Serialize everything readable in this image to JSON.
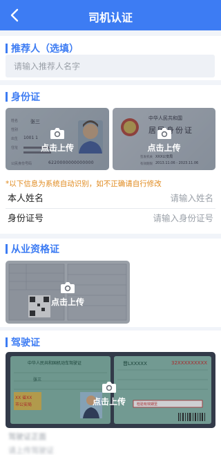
{
  "header": {
    "title": "司机认证",
    "back_icon": "chevron-left-icon"
  },
  "referrer": {
    "title": "推荐人（选填）",
    "placeholder": "请输入推荐人名字"
  },
  "id_card": {
    "title": "身份证",
    "front": {
      "upload_label": "点击上传",
      "card_text": {
        "name_label": "姓名",
        "name": "张三",
        "sex_label": "性别",
        "birth_label": "出生",
        "birth": "1001 1",
        "address_label": "住址",
        "number_label": "公民身份号码",
        "number": "6220000000000000"
      }
    },
    "back": {
      "upload_label": "点击上传",
      "card_text": {
        "country": "中华人民共和国",
        "card_title": "居民身份证",
        "authority": "XXX公安局",
        "valid": "2013.11.06 - 2023.11.06"
      }
    },
    "notice": "*以下信息为系统自动识别，如不正确请自行修改",
    "fields": [
      {
        "label": "本人姓名",
        "placeholder": "请输入姓名"
      },
      {
        "label": "身份证号",
        "placeholder": "请输入身份证号"
      }
    ]
  },
  "qualification": {
    "title": "从业资格证",
    "upload_label": "点击上传"
  },
  "license": {
    "title": "驾驶证",
    "upload_label": "点击上传",
    "card_text": {
      "header": "中华人民共和国机动车驾驶证",
      "name": "张三",
      "number": "32XXXXXXXXX",
      "plate": "晋LXXXXX",
      "footer": "检验有效期至"
    }
  },
  "bottom_blurred": {
    "line1": "驾驶证正面",
    "line2": "请上传驾驶证"
  },
  "colors": {
    "primary": "#3d7cf3",
    "notice": "#e08a1e",
    "background": "#f1f4f9"
  }
}
